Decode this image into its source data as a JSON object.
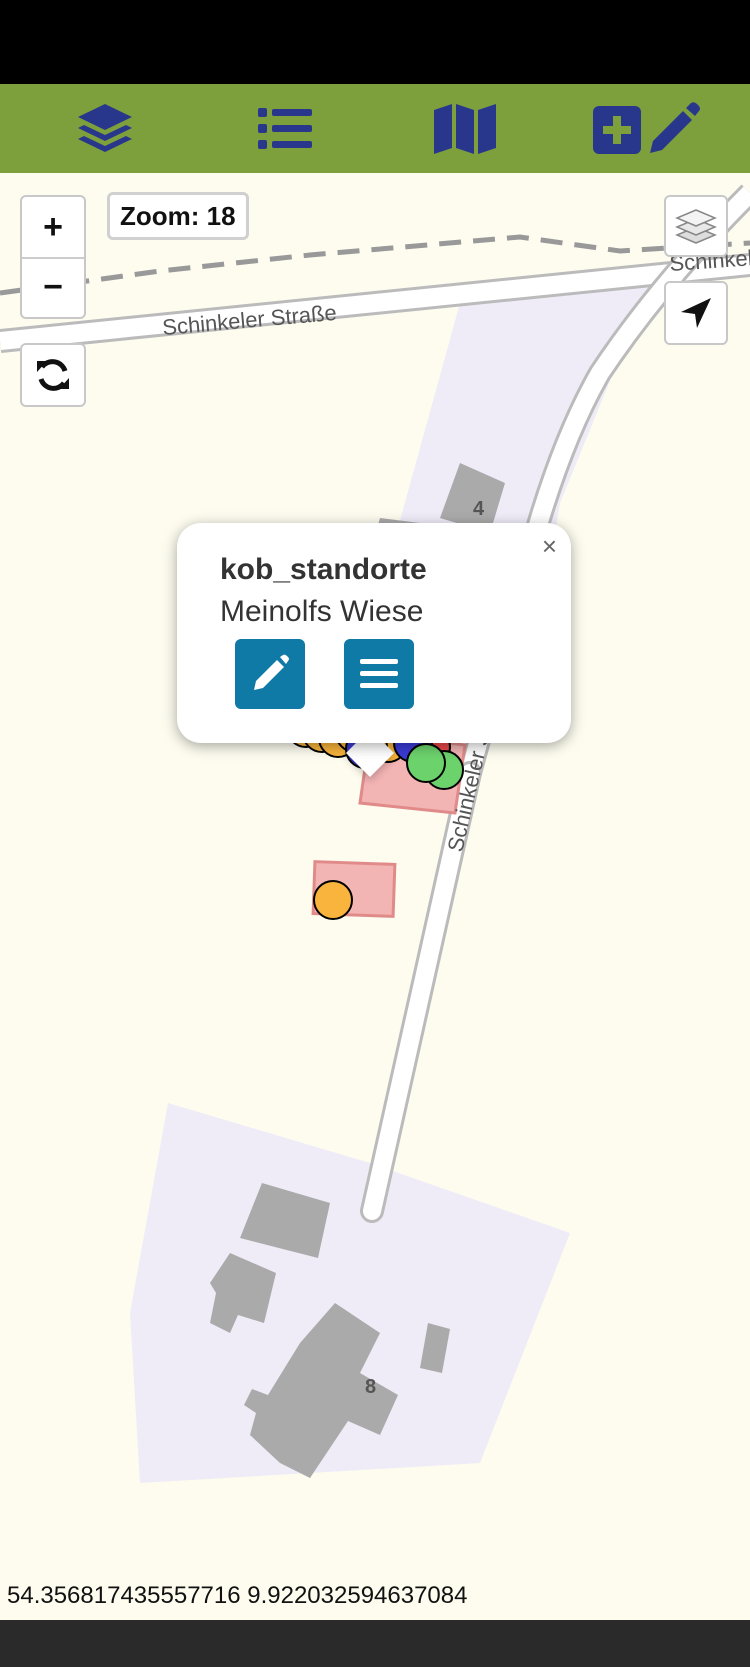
{
  "toolbar": {
    "color": "#7da03c",
    "icon_color": "#28368c",
    "buttons": [
      {
        "name": "layers-icon"
      },
      {
        "name": "list-icon"
      },
      {
        "name": "map-icon"
      },
      {
        "name": "add-edit-icon"
      }
    ]
  },
  "map": {
    "zoom_in_label": "+",
    "zoom_out_label": "−",
    "zoom_label": "Zoom: 18",
    "street_label_1": "Schinkeler Straße",
    "street_label_2": "Schinkel",
    "street_label_3": "Schinkeler S",
    "house_number_1": "4",
    "house_number_2": "8",
    "coordinates": "54.356817435557716 9.922032594637084"
  },
  "popup": {
    "title": "kob_standorte",
    "subtitle": "Meinolfs Wiese",
    "close_label": "×",
    "accent": "#0f7aa6"
  },
  "markers": {
    "colors": {
      "orange": "#f8b43c",
      "blue": "#3b3bd8",
      "green": "#6cd36c",
      "red": "#e84848",
      "beige": "#efe6c8"
    }
  }
}
